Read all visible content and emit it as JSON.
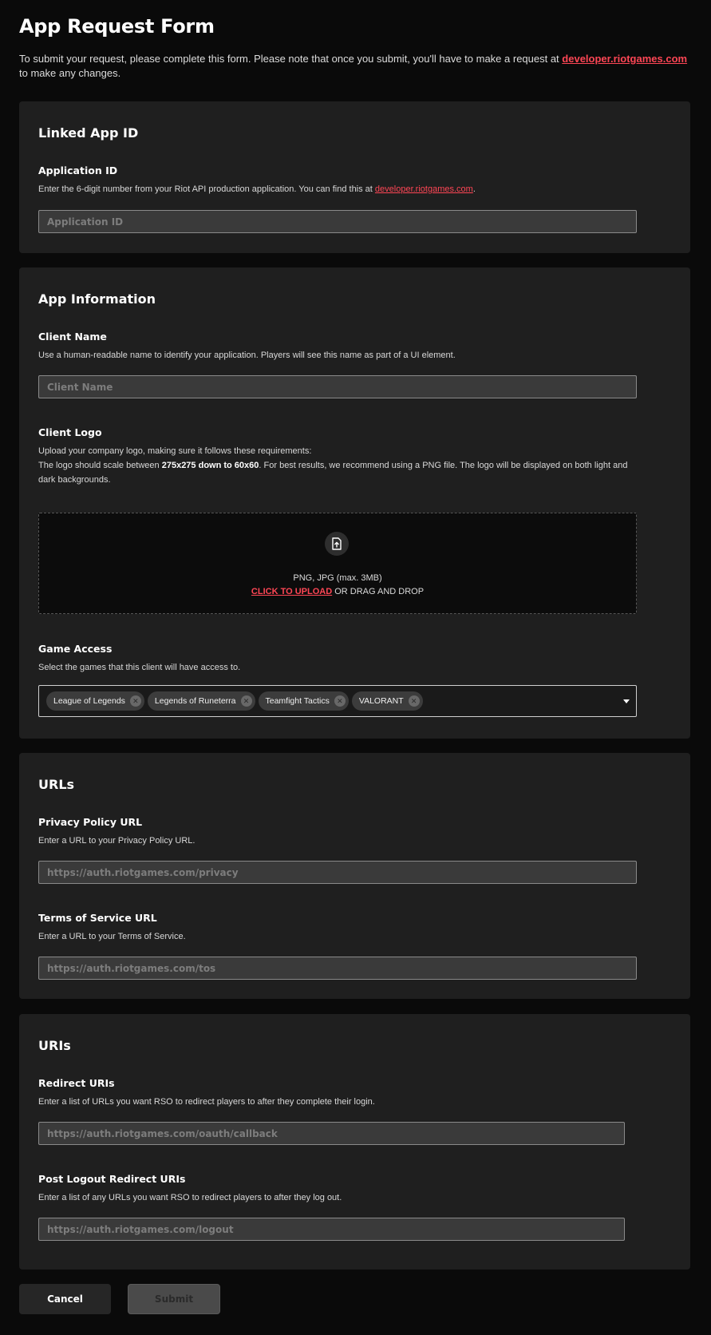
{
  "header": {
    "title": "App Request Form",
    "intro_before_link": "To submit your request, please complete this form. Please note that once you submit, you'll have to make a request at ",
    "intro_link": "developer.riotgames.com",
    "intro_after_link": " to make any changes."
  },
  "linked_app": {
    "section_title": "Linked App ID",
    "application_id": {
      "label": "Application ID",
      "help_before_link": "Enter the 6-digit number from your Riot API production application. You can find this at ",
      "help_link": "developer.riotgames.com",
      "help_after_link": ".",
      "placeholder": "Application ID",
      "value": ""
    }
  },
  "app_information": {
    "section_title": "App Information",
    "client_name": {
      "label": "Client Name",
      "help": "Use a human-readable name to identify your application. Players will see this name as part of a UI element.",
      "placeholder": "Client Name",
      "value": ""
    },
    "client_logo": {
      "label": "Client Logo",
      "help_line1": "Upload your company logo, making sure it follows these requirements:",
      "help_line2_before": "The logo should scale between ",
      "help_line2_bold": "275x275 down to 60x60",
      "help_line2_after": ". For best results, we recommend using a PNG file. The logo will be displayed on both light and dark backgrounds.",
      "dropzone_icon": "file-upload-icon",
      "dropzone_formats": "PNG, JPG (max. 3MB)",
      "dropzone_upload": "CLICK TO UPLOAD",
      "dropzone_drag": " OR DRAG AND DROP"
    },
    "game_access": {
      "label": "Game Access",
      "help": "Select the games that this client will have access to.",
      "selected": [
        {
          "label": "League of Legends"
        },
        {
          "label": "Legends of Runeterra"
        },
        {
          "label": "Teamfight Tactics"
        },
        {
          "label": "VALORANT"
        }
      ]
    }
  },
  "urls": {
    "section_title": "URLs",
    "privacy": {
      "label": "Privacy Policy URL",
      "help": "Enter a URL to your Privacy Policy URL.",
      "placeholder": "https://auth.riotgames.com/privacy",
      "value": ""
    },
    "tos": {
      "label": "Terms of Service URL",
      "help": "Enter a URL to your Terms of Service.",
      "placeholder": "https://auth.riotgames.com/tos",
      "value": ""
    }
  },
  "uris": {
    "section_title": "URIs",
    "redirect": {
      "label": "Redirect URIs",
      "help": "Enter a list of URLs you want RSO to redirect players to after they complete their login.",
      "placeholder": "https://auth.riotgames.com/oauth/callback",
      "value": ""
    },
    "post_logout": {
      "label": "Post Logout Redirect URIs",
      "help": "Enter a list of any URLs you want RSO to redirect players to after they log out.",
      "placeholder": "https://auth.riotgames.com/logout",
      "value": ""
    }
  },
  "actions": {
    "cancel_label": "Cancel",
    "submit_label": "Submit"
  },
  "colors": {
    "accent": "#ff4655",
    "background": "#0a0a0a",
    "card": "#1f1f1f"
  }
}
